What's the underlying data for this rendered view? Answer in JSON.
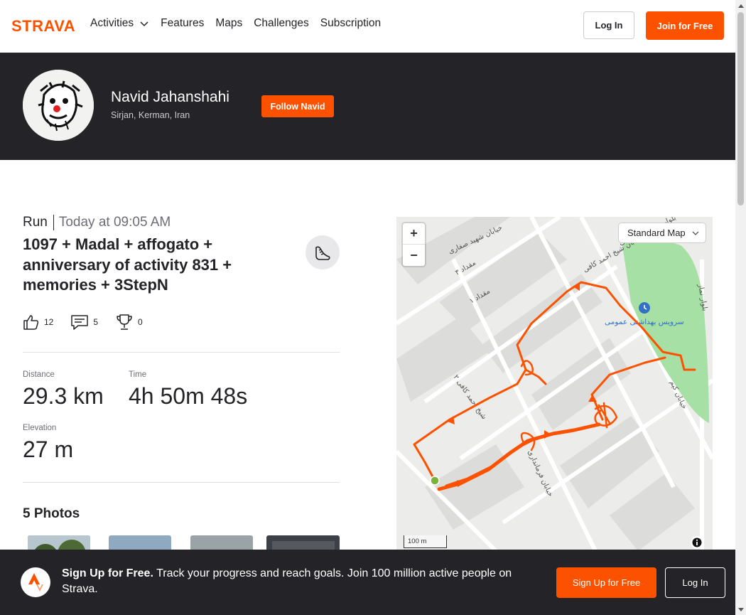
{
  "brand": {
    "logo_text": "STRAVA",
    "accent": "#fc5200",
    "dark": "#242428"
  },
  "nav": {
    "items": [
      {
        "label": "Activities",
        "has_dropdown": true
      },
      {
        "label": "Features"
      },
      {
        "label": "Maps"
      },
      {
        "label": "Challenges"
      },
      {
        "label": "Subscription"
      }
    ],
    "login_label": "Log In",
    "join_label": "Join for Free"
  },
  "athlete": {
    "name": "Navid Jahanshahi",
    "location": "Sirjan, Kerman, Iran",
    "follow_label": "Follow Navid"
  },
  "activity": {
    "type": "Run",
    "time": "Today at 09:05 AM",
    "title": "1097 + Madal + affogato + anniversary of activity 831 + memories + 3StepN",
    "kudos": "12",
    "comments": "5",
    "achievements": "0"
  },
  "stats": {
    "distance_label": "Distance",
    "distance_value": "29.3 km",
    "time_label": "Time",
    "time_value": "4h 50m 48s",
    "elevation_label": "Elevation",
    "elevation_value": "27 m"
  },
  "photos": {
    "title": "5 Photos"
  },
  "map": {
    "style_selected": "Standard Map",
    "zoom_in": "+",
    "zoom_out": "−",
    "scale": "100 m",
    "poi_label": "سرویس بهداشتی عمومی",
    "street_labels": [
      "خیابان شهید صفاری",
      "مقداد ۳",
      "مقداد ۱",
      "خیابان شیخ احمد کافی",
      "شیخ احمد کافی ۲",
      "خیابان فرمانداری",
      "خیابان کیم",
      "بلوار نماز",
      "بلوار شیخ احمد کافی"
    ],
    "route_color": "#fc5200"
  },
  "banner": {
    "headline": "Sign Up for Free.",
    "text": "Track your progress and reach goals. Join 100 million active people on Strava.",
    "signup_label": "Sign Up for Free",
    "login_label": "Log In"
  }
}
